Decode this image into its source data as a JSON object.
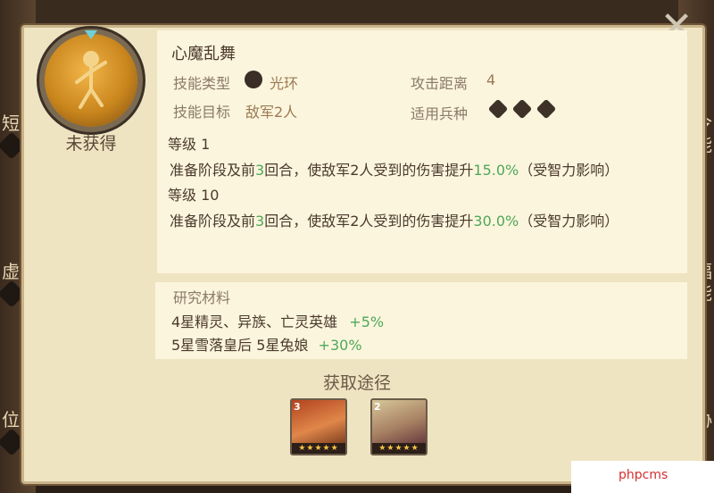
{
  "skill": {
    "name": "心魔乱舞",
    "status": "未获得",
    "type_label": "技能类型",
    "type_value": "光环",
    "target_label": "技能目标",
    "target_value": "敌军2人",
    "range_label": "攻击距离",
    "range_value": "4",
    "troop_label": "适用兵种"
  },
  "levels": [
    {
      "label": "等级 1",
      "pre": "准备阶段及前",
      "rounds": "3",
      "mid": "回合，使敌军2人受到的伤害提升",
      "pct": "15.0%",
      "post": "（受智力影响）"
    },
    {
      "label": "等级 10",
      "pre": "准备阶段及前",
      "rounds": "3",
      "mid": "回合，使敌军2人受到的伤害提升",
      "pct": "30.0%",
      "post": "（受智力影响）"
    }
  ],
  "materials": {
    "title": "研究材料",
    "line1_text": "4星精灵、异族、亡灵英雄",
    "line1_bonus": "+5%",
    "line2_text": "5星雪落皇后 5星兔娘",
    "line2_bonus": "+30%"
  },
  "acquire": {
    "label": "获取途径",
    "heroes": [
      {
        "level": "3",
        "stars": "★★★★★"
      },
      {
        "level": "2",
        "stars": "★★★★★"
      }
    ]
  },
  "side": {
    "l1": "短",
    "l2": "虚",
    "l3": "位",
    "r1": "令",
    "r2": "能",
    "r3": "福",
    "r4": "能",
    "r5": "协"
  },
  "watermark": "phpcms"
}
